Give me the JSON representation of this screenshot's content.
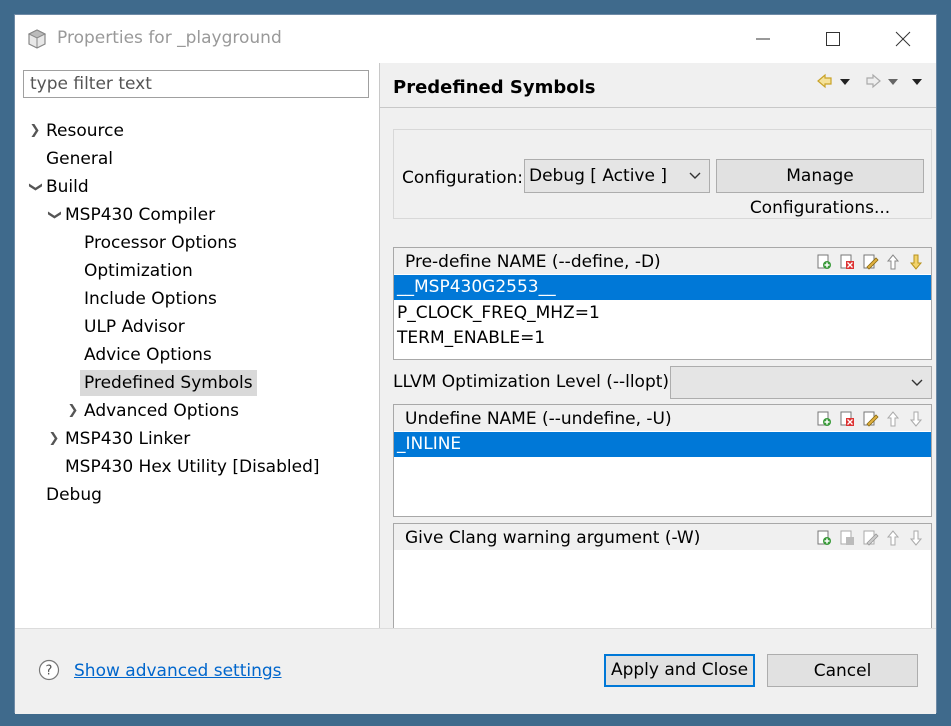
{
  "window": {
    "title": "Properties for _playground"
  },
  "filter": {
    "placeholder": "type filter text"
  },
  "tree": {
    "resource": "Resource",
    "general": "General",
    "build": "Build",
    "compiler": "MSP430 Compiler",
    "processor_options": "Processor Options",
    "optimization": "Optimization",
    "include_options": "Include Options",
    "ulp_advisor": "ULP Advisor",
    "advice_options": "Advice Options",
    "predefined_symbols": "Predefined Symbols",
    "advanced_options": "Advanced Options",
    "linker": "MSP430 Linker",
    "hex_utility": "MSP430 Hex Utility  [Disabled]",
    "debug": "Debug"
  },
  "page": {
    "title": "Predefined Symbols",
    "configuration_label": "Configuration:",
    "configuration_value": "Debug  [ Active ]",
    "manage_button": "Manage Configurations..."
  },
  "predefine": {
    "title": "Pre-define NAME (--define, -D)",
    "items": [
      "__MSP430G2553__",
      "P_CLOCK_FREQ_MHZ=1",
      "TERM_ENABLE=1"
    ]
  },
  "llvm": {
    "label": "LLVM Optimization Level (--llopt)",
    "value": ""
  },
  "undefine": {
    "title": "Undefine NAME (--undefine, -U)",
    "items": [
      "_INLINE"
    ]
  },
  "clang": {
    "title": "Give Clang warning argument (-W)",
    "items": []
  },
  "footer": {
    "advanced_link": "Show advanced settings",
    "apply_close": "Apply and Close",
    "cancel": "Cancel"
  },
  "colors": {
    "selection": "#0078d7",
    "tree_selection": "#d9d9d9",
    "link": "#0066cc"
  }
}
